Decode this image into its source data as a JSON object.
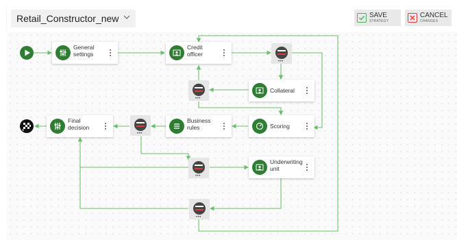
{
  "header": {
    "strategy_name": "Retail_Constructor_new",
    "save_label": "SAVE",
    "save_sub": "STRATEGY",
    "cancel_label": "CANCEL",
    "cancel_sub": "CHANGES"
  },
  "nodes": {
    "general_settings": [
      "General",
      "settings"
    ],
    "credit_officer": [
      "Credit",
      "officer"
    ],
    "collateral": "Collateral",
    "scoring": "Scoring",
    "business_rules": [
      "Business",
      "rules"
    ],
    "final_decision": [
      "Final",
      "decision"
    ],
    "underwriting_unit": [
      "Underwriting",
      "unit"
    ]
  },
  "gateway_more": "•••",
  "colors": {
    "accent": "#2e7d32",
    "connector": "#6cbf6c",
    "save_icon": "#4caf50",
    "cancel_icon": "#e53935"
  },
  "icons": {
    "start": "play-icon",
    "finish": "checkered-flag-icon",
    "gateway": "split-gateway-icon",
    "general_settings": "sliders-icon",
    "credit_officer": "person-card-icon",
    "collateral": "person-card-icon",
    "scoring": "gauge-icon",
    "business_rules": "list-icon",
    "final_decision": "sliders-icon",
    "underwriting_unit": "person-card-icon"
  }
}
